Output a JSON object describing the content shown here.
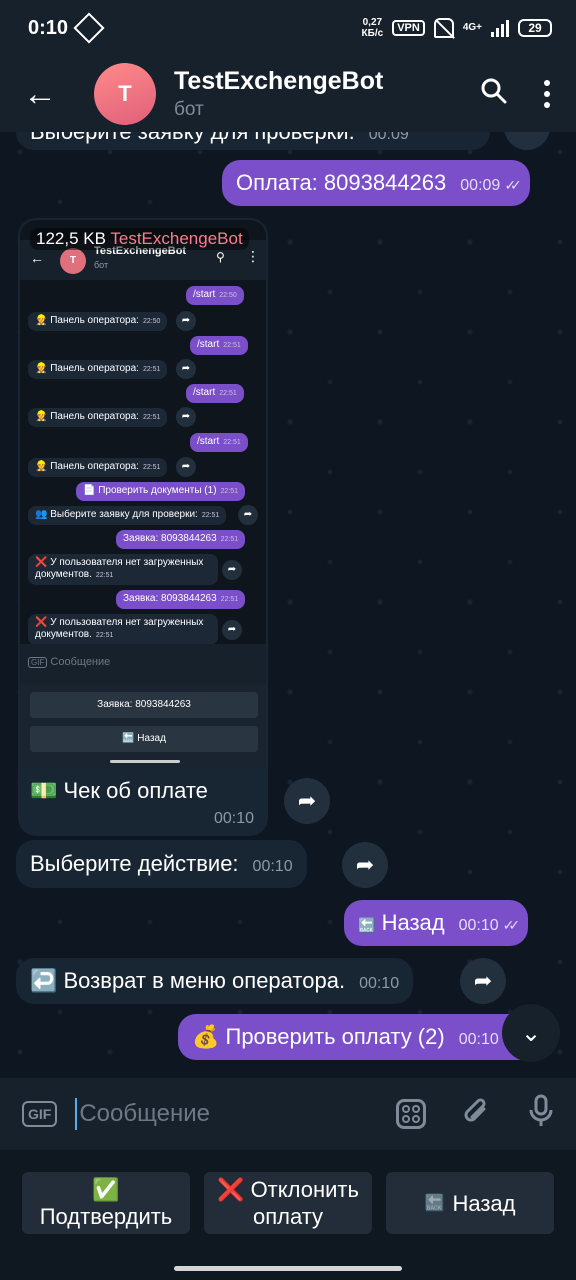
{
  "status": {
    "time": "0:10",
    "net_speed_value": "0,27",
    "net_speed_unit": "КБ/с",
    "vpn": "VPN",
    "net_type": "4G+",
    "battery": "29"
  },
  "header": {
    "avatar_letter": "T",
    "title": "TestExchengeBot",
    "subtitle": "бот"
  },
  "messages": {
    "m0_text": "Выберите заявку для проверки:",
    "m0_time": "00:09",
    "m1_text": "Оплата: 8093844263",
    "m1_time": "00:09",
    "shot_size": "122,5 KB",
    "shot_sender": "TestExchengeBot",
    "shot_caption": "💵 Чек об оплате",
    "shot_time": "00:10",
    "m3_text": "Выберите действие:",
    "m3_time": "00:10",
    "m4_text": "Назад",
    "m4_time": "00:10",
    "m5_text": "↩️ Возврат в меню оператора.",
    "m5_time": "00:10",
    "m6_text": "💰 Проверить оплату (2)",
    "m6_time": "00:10"
  },
  "mini": {
    "title": "TestExchengeBot",
    "subtitle": "бот",
    "start": "/start",
    "panel": "Панель оператора:",
    "check_docs": "Проверить документы (1)",
    "choose": "Выберите заявку для проверки:",
    "request": "Заявка: 8093844263",
    "no_docs_1": "У пользователя нет загруженных",
    "no_docs_2": "документов.",
    "t2250": "22:50",
    "t2251": "22:51",
    "input_placeholder": "Сообщение",
    "kb_request": "Заявка: 8093844263",
    "kb_back": "Назад"
  },
  "input": {
    "gif": "GIF",
    "placeholder": "Сообщение"
  },
  "keyboard": {
    "confirm": "✅\nПодтвердить",
    "reject": "❌ Отклонить\nоплату",
    "back": "Назад"
  }
}
